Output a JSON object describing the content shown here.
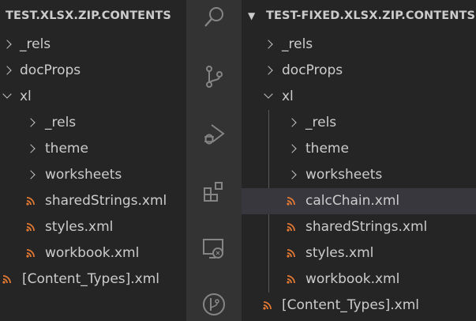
{
  "left_panel": {
    "title": "TEST.XLSX.ZIP.CONTENTS",
    "items": [
      {
        "label": "_rels"
      },
      {
        "label": "docProps"
      },
      {
        "label": "xl"
      },
      {
        "label": "_rels"
      },
      {
        "label": "theme"
      },
      {
        "label": "worksheets"
      },
      {
        "label": "sharedStrings.xml"
      },
      {
        "label": "styles.xml"
      },
      {
        "label": "workbook.xml"
      },
      {
        "label": "[Content_Types].xml"
      }
    ]
  },
  "right_panel": {
    "title": "TEST-FIXED.XLSX.ZIP.CONTENTS",
    "items": [
      {
        "label": "_rels"
      },
      {
        "label": "docProps"
      },
      {
        "label": "xl"
      },
      {
        "label": "_rels"
      },
      {
        "label": "theme"
      },
      {
        "label": "worksheets"
      },
      {
        "label": "calcChain.xml"
      },
      {
        "label": "sharedStrings.xml"
      },
      {
        "label": "styles.xml"
      },
      {
        "label": "workbook.xml"
      },
      {
        "label": "[Content_Types].xml"
      }
    ]
  },
  "activity_bar": {
    "icons": [
      "search-icon",
      "source-control-icon",
      "run-debug-icon",
      "extensions-icon",
      "remote-explorer-icon",
      "git-graph-icon"
    ]
  },
  "colors": {
    "sidebar_bg": "#252526",
    "activity_bg": "#333333",
    "text": "#cccccc",
    "selected_row": "#37373d",
    "xml_icon": "#e37933",
    "activity_icon": "#858585"
  }
}
